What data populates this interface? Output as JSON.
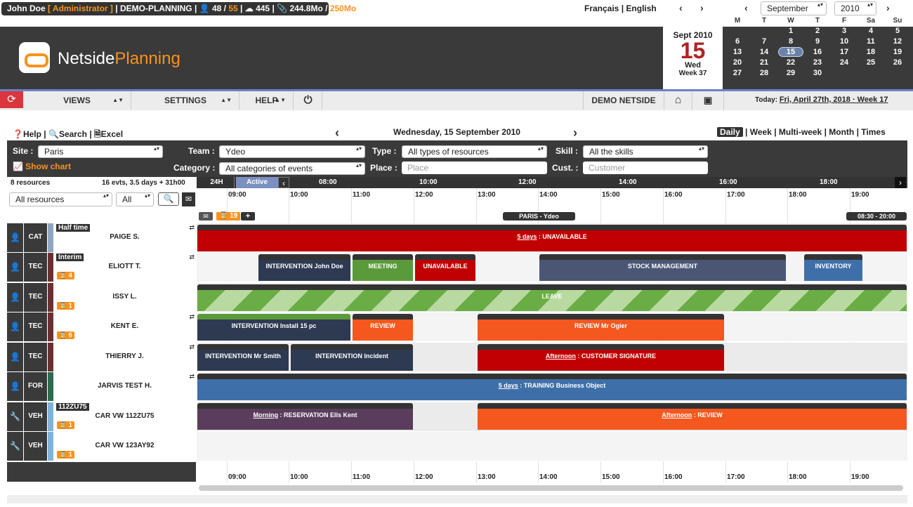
{
  "user": {
    "name": "John Doe",
    "role": "Administrator",
    "planning": "DEMO-PLANNING",
    "users_used": "48",
    "users_max": "55",
    "cloud": "445",
    "storage_used": "244.8Mo",
    "storage_max": "250Mo"
  },
  "langs": {
    "fr": "Français",
    "sep": "|",
    "en": "English"
  },
  "cal": {
    "month": "September",
    "year": "2010",
    "days": [
      "M",
      "T",
      "W",
      "T",
      "F",
      "Sa",
      "Su"
    ],
    "weeks": [
      [
        "",
        "",
        "1",
        "2",
        "3",
        "4",
        "5"
      ],
      [
        "6",
        "7",
        "8",
        "9",
        "10",
        "11",
        "12"
      ],
      [
        "13",
        "14",
        "15",
        "16",
        "17",
        "18",
        "19"
      ],
      [
        "20",
        "21",
        "22",
        "23",
        "24",
        "25",
        "26"
      ],
      [
        "27",
        "28",
        "29",
        "30",
        "",
        "",
        ""
      ]
    ]
  },
  "datebox": {
    "month_year": "Sept 2010",
    "day": "15",
    "weekday": "Wed",
    "week": "Week 37"
  },
  "logo": {
    "a": "Netside",
    "b": "Planning"
  },
  "nav": {
    "views": "VIEWS",
    "settings": "SETTINGS",
    "help": "HELP",
    "org": "DEMO NETSIDE",
    "today_label": "Today:",
    "today": "Fri, April 27th, 2018 · Week 17"
  },
  "toolbar": {
    "help": "Help",
    "search": "Search",
    "excel": "Excel",
    "date": "Wednesday, 15 September 2010",
    "views": [
      "Daily",
      "Week",
      "Multi-week",
      "Month",
      "Times"
    ]
  },
  "filters": {
    "site_label": "Site :",
    "site": "Paris",
    "team_label": "Team :",
    "team": "Ydeo",
    "type_label": "Type :",
    "type": "All types of resources",
    "skill_label": "Skill :",
    "skill": "All the skills",
    "chart": "Show chart",
    "category_label": "Category :",
    "category": "All categories of events",
    "place_label": "Place :",
    "place_ph": "Place",
    "cust_label": "Cust. :",
    "cust_ph": "Customer"
  },
  "summary": {
    "resources": "8 resources",
    "events": "16 evts, 3.5 days + 31h00",
    "all_resources": "All resources",
    "all": "All",
    "h24": "24H",
    "active": "Active"
  },
  "hours_top": [
    "08:00",
    "10:00",
    "12:00",
    "14:00",
    "16:00",
    "18:00"
  ],
  "hours": [
    "09:00",
    "10:00",
    "11:00",
    "12:00",
    "13:00",
    "14:00",
    "15:00",
    "16:00",
    "17:00",
    "18:00",
    "19:00"
  ],
  "group": {
    "count": "19",
    "name": "PARIS - Ydeo",
    "time": "08:30 - 20:00"
  },
  "resources": [
    {
      "cat": "CAT",
      "name": "PAIGE S.",
      "tag": "Half time",
      "badge": "",
      "color": "#8fa6bf",
      "icon": "person"
    },
    {
      "cat": "TEC",
      "name": "ELIOTT T.",
      "tag": "Interim",
      "badge": "4",
      "color": "#6b3030",
      "icon": "person"
    },
    {
      "cat": "TEC",
      "name": "ISSY L.",
      "tag": "",
      "badge": "1",
      "color": "#6b3030",
      "icon": "person"
    },
    {
      "cat": "TEC",
      "name": "KENT E.",
      "tag": "",
      "badge": "6",
      "color": "#6b3030",
      "icon": "person"
    },
    {
      "cat": "TEC",
      "name": "THIERRY J.",
      "tag": "",
      "badge": "",
      "color": "#6b3030",
      "icon": "person"
    },
    {
      "cat": "FOR",
      "name": "JARVIS TEST H.",
      "tag": "",
      "badge": "",
      "color": "#2d6b50",
      "icon": "person"
    },
    {
      "cat": "VEH",
      "name": "CAR VW 112ZU75",
      "tag": "112ZU75",
      "badge": "1",
      "color": "#7fb3d9",
      "icon": "wrench"
    },
    {
      "cat": "VEH",
      "name": "CAR VW 123AY92",
      "tag": "",
      "badge": "1",
      "color": "#7fb3d9",
      "icon": "wrench"
    }
  ],
  "events": {
    "e1": {
      "pre": "5 days",
      "txt": " : UNAVAILABLE"
    },
    "e2": "INTERVENTION John Doe",
    "e3": "MEETING",
    "e4": "UNAVAILABLE",
    "e5": "STOCK MANAGEMENT",
    "e6": "INVENTORY",
    "e7": "LEAVE",
    "e8": "INTERVENTION Install 15 pc",
    "e9": "REVIEW",
    "e10": "REVIEW Mr Ogier",
    "e11": "INTERVENTION Mr Smith",
    "e12": "INTERVENTION Incident",
    "e13": {
      "pre": "Afternoon",
      "txt": " : CUSTOMER SIGNATURE"
    },
    "e14": {
      "pre": "5 days",
      "txt": " : TRAINING Business Object"
    },
    "e15": {
      "pre": "Morning",
      "txt": " : RESERVATION Ells Kent"
    },
    "e16": {
      "pre": "Afternoon",
      "txt": " : REVIEW"
    }
  },
  "colors": {
    "red": "#c00000",
    "orange": "#f4581e",
    "navy": "#2e3a52",
    "green": "#5a9a3a",
    "slate": "#4a5674",
    "blue": "#3f6fa8",
    "purple": "#5a3d5c",
    "orange_brand": "#f7931e"
  }
}
